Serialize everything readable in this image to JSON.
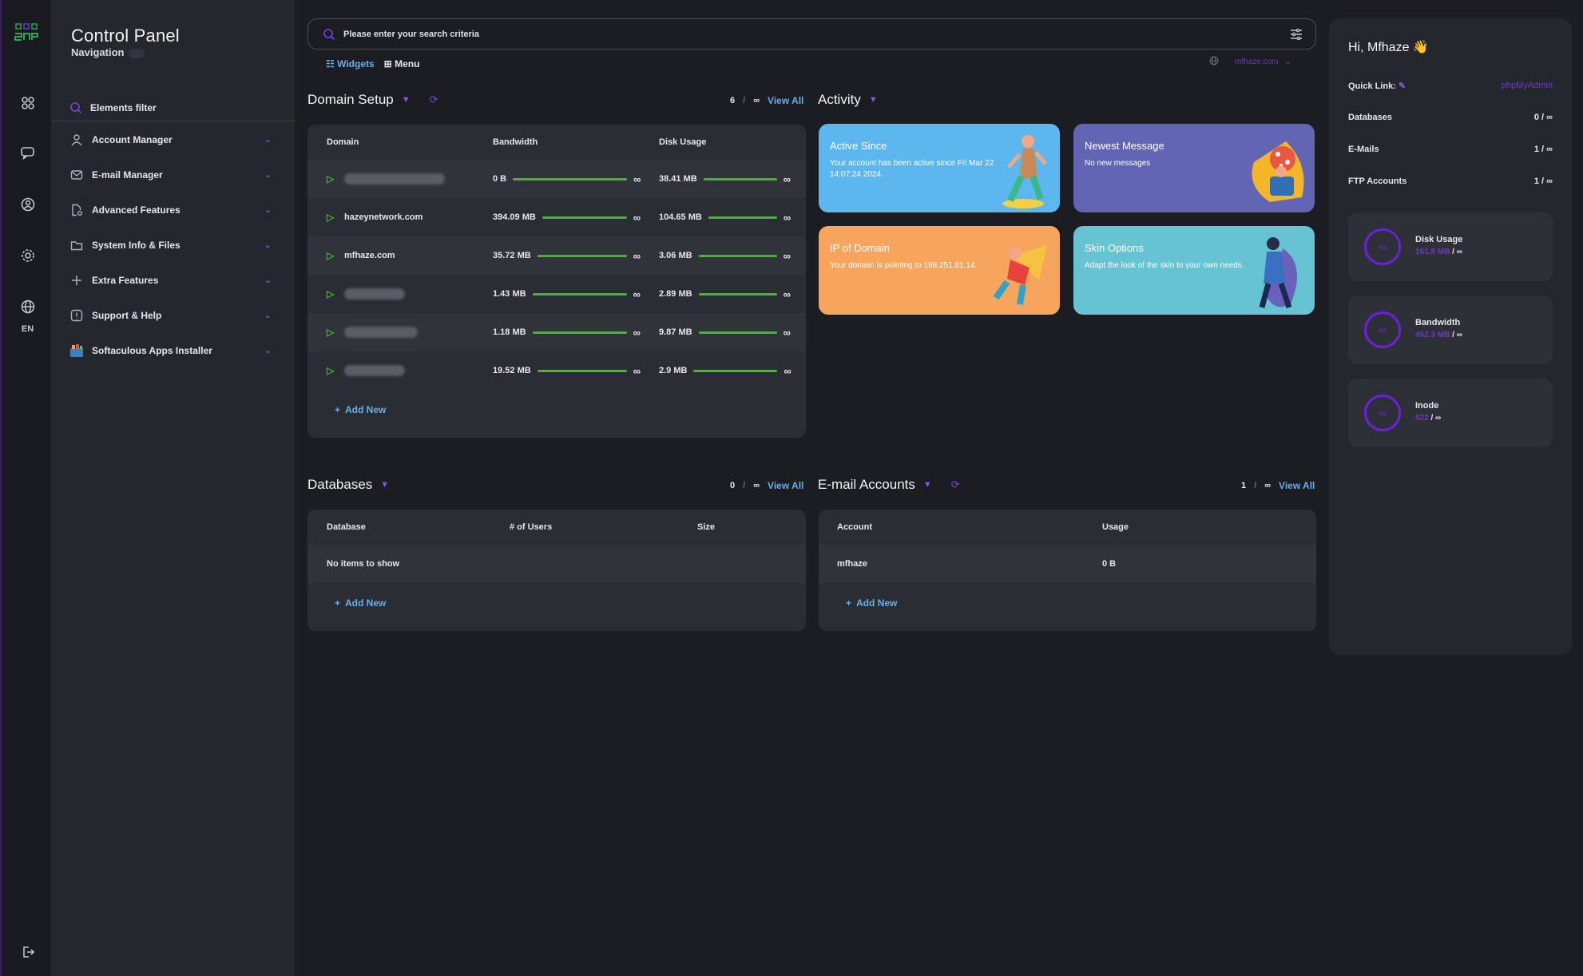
{
  "rail": {
    "icons": [
      "dashboard-icon",
      "chat-icon",
      "user-circle-icon",
      "gear-icon",
      "globe-icon",
      "logout-icon"
    ],
    "language": "EN"
  },
  "nav": {
    "title": "Control Panel",
    "subtitle": "Navigation",
    "filter_label": "Elements filter",
    "items": [
      {
        "label": "Account Manager",
        "icon": "user-icon"
      },
      {
        "label": "E-mail Manager",
        "icon": "mail-icon"
      },
      {
        "label": "Advanced Features",
        "icon": "file-gear-icon"
      },
      {
        "label": "System Info & Files",
        "icon": "folder-icon"
      },
      {
        "label": "Extra Features",
        "icon": "plus-icon"
      },
      {
        "label": "Support & Help",
        "icon": "alert-icon"
      },
      {
        "label": "Softaculous Apps Installer",
        "icon": "softaculous-icon"
      }
    ]
  },
  "search": {
    "placeholder": "Please enter your search criteria"
  },
  "view": {
    "widgets": "Widgets",
    "menu": "Menu"
  },
  "domain_selector": {
    "value": "mfhaze.com"
  },
  "domain_setup": {
    "title": "Domain Setup",
    "count": "6",
    "limit": "∞",
    "view_all": "View All",
    "columns": [
      "Domain",
      "Bandwidth",
      "Disk Usage"
    ],
    "rows": [
      {
        "domain": "",
        "bandwidth": "0 B",
        "disk": "38.41 MB",
        "bw_fill": 1.0,
        "disk_fill": 1.0
      },
      {
        "domain": "hazeynetwork.com",
        "bandwidth": "394.09 MB",
        "disk": "104.65 MB",
        "bw_fill": 1.0,
        "disk_fill": 1.0
      },
      {
        "domain": "mfhaze.com",
        "bandwidth": "35.72 MB",
        "disk": "3.06 MB",
        "bw_fill": 1.0,
        "disk_fill": 1.0
      },
      {
        "domain": "",
        "bandwidth": "1.43 MB",
        "disk": "2.89 MB",
        "bw_fill": 1.0,
        "disk_fill": 1.0
      },
      {
        "domain": "",
        "bandwidth": "1.18 MB",
        "disk": "9.87 MB",
        "bw_fill": 1.0,
        "disk_fill": 1.0
      },
      {
        "domain": "",
        "bandwidth": "19.52 MB",
        "disk": "2.9 MB",
        "bw_fill": 1.0,
        "disk_fill": 1.0
      }
    ],
    "add_new": "Add New"
  },
  "activity": {
    "title": "Activity",
    "tiles": [
      {
        "title": "Active Since",
        "desc": "Your account has been active since Fri Mar 22 14:07:24 2024.",
        "color": "#5bb7ee"
      },
      {
        "title": "Newest Message",
        "desc": "No new messages",
        "color": "#6265b4"
      },
      {
        "title": "IP of Domain",
        "desc": "Your domain is pointing to 198.251.81.14.",
        "color": "#f7a55c"
      },
      {
        "title": "Skin Options",
        "desc": "Adapt the look of the skin to your own needs.",
        "color": "#66c3d2"
      }
    ]
  },
  "databases": {
    "title": "Databases",
    "count": "0",
    "limit": "∞",
    "view_all": "View All",
    "columns": [
      "Database",
      "# of Users",
      "Size"
    ],
    "empty": "No items to show",
    "add_new": "Add New"
  },
  "email_accounts": {
    "title": "E-mail Accounts",
    "count": "1",
    "limit": "∞",
    "view_all": "View All",
    "columns": [
      "Account",
      "Usage"
    ],
    "rows": [
      {
        "account": "mfhaze",
        "usage": "0 B"
      }
    ],
    "add_new": "Add New"
  },
  "right_panel": {
    "greeting": "Hi, Mfhaze 👋",
    "quick_link_label": "Quick Link:",
    "quick_link_value": "phpMyAdmin",
    "stats": [
      {
        "label": "Databases",
        "value": "0 / ∞"
      },
      {
        "label": "E-Mails",
        "value": "1 / ∞"
      },
      {
        "label": "FTP Accounts",
        "value": "1 / ∞"
      }
    ],
    "usage": [
      {
        "label": "Disk Usage",
        "value": "161.8 MB",
        "limit": "/ ∞"
      },
      {
        "label": "Bandwidth",
        "value": "452.3 MB",
        "limit": "/ ∞"
      },
      {
        "label": "Inode",
        "value": "522",
        "limit": "/ ∞"
      }
    ]
  },
  "colors": {
    "accent": "#6b1fe0",
    "link": "#67b0e8",
    "bar": "#3fbb2a"
  }
}
